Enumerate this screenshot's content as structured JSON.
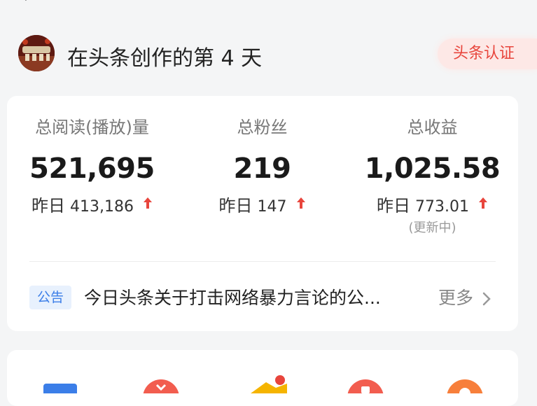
{
  "header": {
    "title": "在头条创作的第 4 天",
    "badge": "头条认证"
  },
  "stats": [
    {
      "label": "总阅读(播放)量",
      "value": "521,695",
      "yesterday_prefix": "昨日",
      "yesterday_value": "413,186",
      "trend": "up"
    },
    {
      "label": "总粉丝",
      "value": "219",
      "yesterday_prefix": "昨日",
      "yesterday_value": "147",
      "trend": "up"
    },
    {
      "label": "总收益",
      "value": "1,025.58",
      "yesterday_prefix": "昨日",
      "yesterday_value": "773.01",
      "trend": "up",
      "status": "(更新中)"
    }
  ],
  "notice": {
    "tag": "公告",
    "text": "今日头条关于打击网络暴力言论的公...",
    "more": "更多"
  },
  "colors": {
    "accent_red": "#e8453c",
    "notice_blue": "#3b7ee8",
    "background": "#f4f5f6"
  },
  "icons": [
    "chevron-right-icon",
    "arrow-up-icon"
  ]
}
